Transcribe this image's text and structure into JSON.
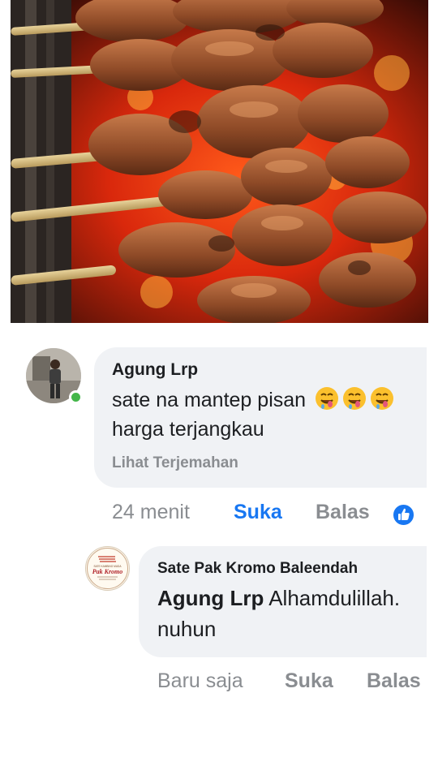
{
  "post": {
    "photo_icon": "satay-grill-photo"
  },
  "comment": {
    "author": "Agung Lrp",
    "text_line1": "sate na mantep pisan",
    "text_line2": "harga terjangkau",
    "emoji": [
      "drooling-face-icon",
      "drooling-face-icon",
      "drooling-face-icon"
    ],
    "see_translation": "Lihat Terjemahan",
    "time": "24 menit",
    "like_label": "Suka",
    "reply_label": "Balas",
    "reaction_icon": "like-reaction-icon",
    "online": true
  },
  "reply": {
    "author": "Sate Pak Kromo Baleendah",
    "mention": "Agung Lrp",
    "text_line1": "Alhamdulillah.",
    "text_line2": "nuhun",
    "time": "Baru saja",
    "like_label": "Suka",
    "reply_label": "Balas",
    "avatar_logo_text": "Pak Kromo",
    "avatar_logo_small": "SATE KAMBING MUDA"
  },
  "colors": {
    "bubble": "#f0f2f5",
    "text": "#1c1e21",
    "muted": "#8a8d91",
    "link": "#1877f2",
    "online": "#43b649"
  }
}
